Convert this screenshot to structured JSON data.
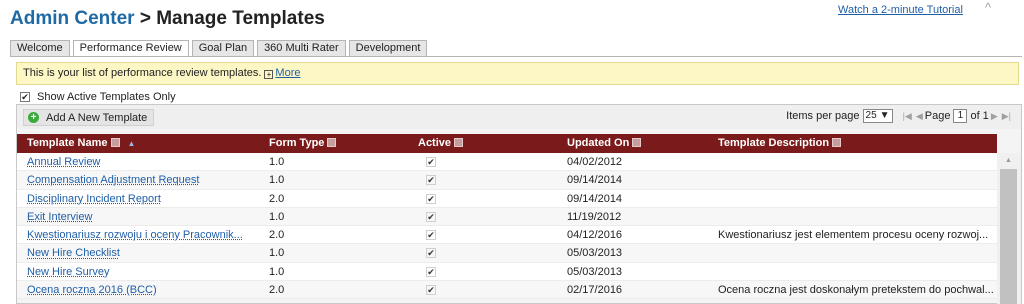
{
  "header": {
    "title_link": "Admin Center",
    "title_sep": " > ",
    "title_rest": "Manage Templates",
    "tutorial_link": "Watch a 2-minute Tutorial",
    "collapse_glyph": "^"
  },
  "tabs": [
    {
      "label": "Welcome",
      "active": false
    },
    {
      "label": "Performance Review",
      "active": true
    },
    {
      "label": "Goal Plan",
      "active": false
    },
    {
      "label": "360 Multi Rater",
      "active": false
    },
    {
      "label": "Development",
      "active": false
    }
  ],
  "info_bar": {
    "text": "This is your list of performance review templates.",
    "more_link": "More"
  },
  "filter": {
    "show_active_label": "Show Active Templates Only",
    "checked": true
  },
  "toolbar": {
    "add_label": "Add A New Template",
    "items_per_page_label": "Items per page",
    "items_per_page_value": "25",
    "page_label": "Page",
    "page_value": "1",
    "of_label": "of 1"
  },
  "table": {
    "columns": [
      "Template Name",
      "Form Type",
      "Active",
      "Updated On",
      "Template Description"
    ],
    "rows": [
      {
        "name": "Annual Review",
        "form_type": "1.0",
        "active": true,
        "updated": "04/02/2012",
        "description": ""
      },
      {
        "name": "Compensation Adjustment Request",
        "form_type": "1.0",
        "active": true,
        "updated": "09/14/2014",
        "description": ""
      },
      {
        "name": "Disciplinary Incident Report",
        "form_type": "2.0",
        "active": true,
        "updated": "09/14/2014",
        "description": ""
      },
      {
        "name": "Exit Interview",
        "form_type": "1.0",
        "active": true,
        "updated": "11/19/2012",
        "description": ""
      },
      {
        "name": "Kwestionariusz rozwoju i oceny Pracownik...",
        "form_type": "2.0",
        "active": true,
        "updated": "04/12/2016",
        "description": "Kwestionariusz jest elementem procesu oceny rozwoj..."
      },
      {
        "name": "New Hire Checklist",
        "form_type": "1.0",
        "active": true,
        "updated": "05/03/2013",
        "description": ""
      },
      {
        "name": "New Hire Survey",
        "form_type": "1.0",
        "active": true,
        "updated": "05/03/2013",
        "description": ""
      },
      {
        "name": "Ocena roczna 2016 (BCC)",
        "form_type": "2.0",
        "active": true,
        "updated": "02/17/2016",
        "description": "Ocena roczna jest doskonałym pretekstem do pochwal..."
      }
    ]
  },
  "colors": {
    "header_row": "#7b1a1a",
    "info_bg": "#fdf7c5",
    "link": "#1f5fa8"
  }
}
